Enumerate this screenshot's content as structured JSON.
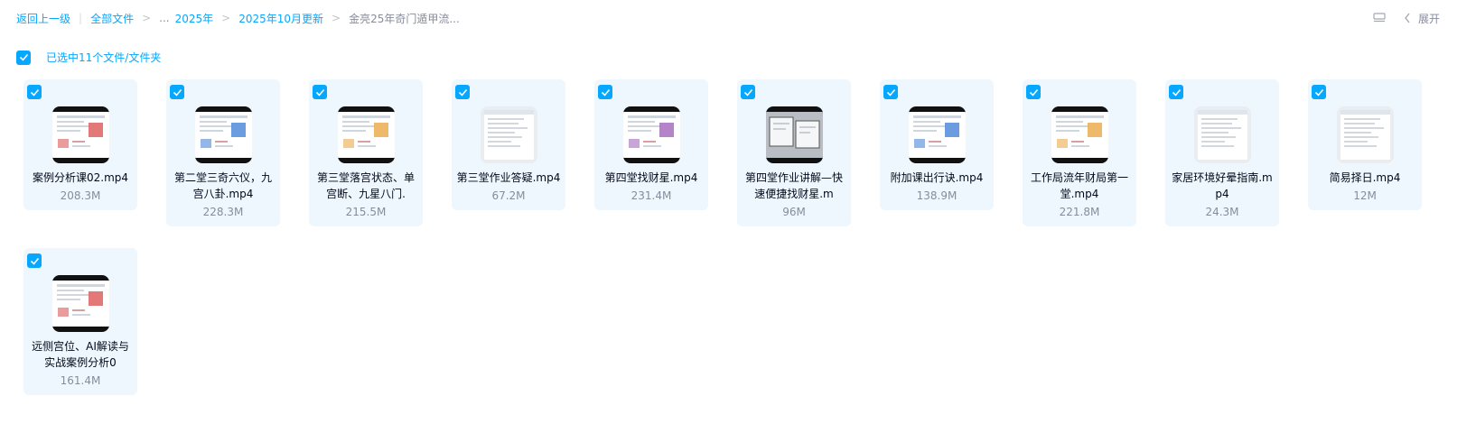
{
  "breadcrumb": {
    "back": "返回上一级",
    "divider": "|",
    "all_files": "全部文件",
    "sep": ">",
    "ellipsis": "...",
    "year": "2025年",
    "month": "2025年10月更新",
    "current": "金亮25年奇门遁甲流..."
  },
  "top_right": {
    "list_icon": "list-view-icon",
    "expand_icon": "chevron-left-icon",
    "expand_label": "展开"
  },
  "selection": {
    "text": "已选中11个文件/文件夹",
    "checked": true
  },
  "colors": {
    "accent": "#06a7ff",
    "card_bg": "#eef7fd",
    "text": "#03081a",
    "muted": "#878c9c"
  },
  "files": [
    {
      "name": "案例分析课02.mp4",
      "size": "208.3M",
      "thumb": "dark"
    },
    {
      "name": "第二堂三奇六仪，九宫八卦.mp4",
      "size": "228.3M",
      "thumb": "dark"
    },
    {
      "name": "第三堂落宫状态、单宫断、九星八门.",
      "size": "215.5M",
      "thumb": "dark"
    },
    {
      "name": "第三堂作业答疑.mp4",
      "size": "67.2M",
      "thumb": "light"
    },
    {
      "name": "第四堂找财星.mp4",
      "size": "231.4M",
      "thumb": "dark"
    },
    {
      "name": "第四堂作业讲解—快速便捷找财星.m",
      "size": "96M",
      "thumb": "device"
    },
    {
      "name": "附加课出行诀.mp4",
      "size": "138.9M",
      "thumb": "dark"
    },
    {
      "name": "工作局流年财局第一堂.mp4",
      "size": "221.8M",
      "thumb": "dark"
    },
    {
      "name": "家居环境好晕指南.mp4",
      "size": "24.3M",
      "thumb": "light"
    },
    {
      "name": "简易择日.mp4",
      "size": "12M",
      "thumb": "light"
    },
    {
      "name": "远侧宫位、AI解读与实战案例分析0",
      "size": "161.4M",
      "thumb": "dark"
    }
  ]
}
